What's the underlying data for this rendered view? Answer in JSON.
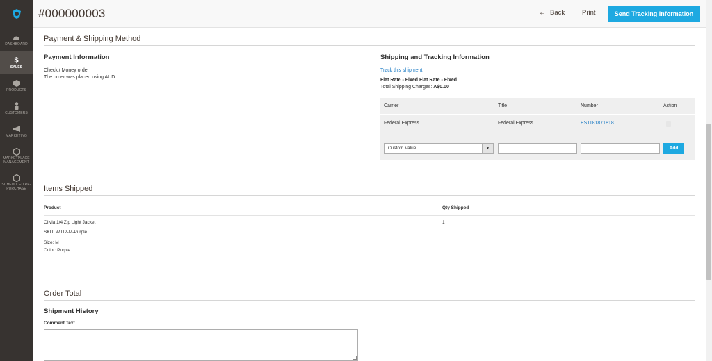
{
  "sidebar": {
    "items": [
      {
        "label": "DASHBOARD",
        "icon": "dashboard-icon"
      },
      {
        "label": "SALES",
        "icon": "dollar-icon"
      },
      {
        "label": "PRODUCTS",
        "icon": "cube-icon"
      },
      {
        "label": "CUSTOMERS",
        "icon": "user-icon"
      },
      {
        "label": "MARKETING",
        "icon": "megaphone-icon"
      },
      {
        "label": "MARKETPLACE MANAGEMENT",
        "icon": "hexagon-icon"
      },
      {
        "label": "SCHEDULED RE-PURCHASE",
        "icon": "hexagon-icon"
      }
    ]
  },
  "header": {
    "title": "#000000003",
    "back_label": "Back",
    "print_label": "Print",
    "send_label": "Send Tracking Information"
  },
  "payment_shipping": {
    "section_title": "Payment & Shipping Method",
    "payment_title": "Payment Information",
    "payment_method": "Check / Money order",
    "payment_currency_note": "The order was placed using AUD.",
    "shipping_title": "Shipping and Tracking Information",
    "track_link": "Track this shipment",
    "shipping_method": "Flat Rate - Fixed Flat Rate - Fixed",
    "charges_label": "Total Shipping Charges: ",
    "charges_value": "A$0.00"
  },
  "tracking_table": {
    "headers": [
      "Carrier",
      "Title",
      "Number",
      "Action"
    ],
    "rows": [
      {
        "carrier": "Federal Express",
        "title": "Federal Express",
        "number": "ES1181871818"
      }
    ],
    "carrier_select_value": "Custom Value",
    "add_label": "Add"
  },
  "items_shipped": {
    "section_title": "Items Shipped",
    "headers": [
      "Product",
      "Qty Shipped"
    ],
    "items": [
      {
        "name": "Olivia 1/4 Zip Light Jacket",
        "sku": "SKU: WJ12-M-Purple",
        "size": "Size: M",
        "color": "Color: Purple",
        "qty": "1"
      }
    ]
  },
  "order_total": {
    "section_title": "Order Total",
    "history_title": "Shipment History",
    "comment_label": "Comment Text"
  }
}
